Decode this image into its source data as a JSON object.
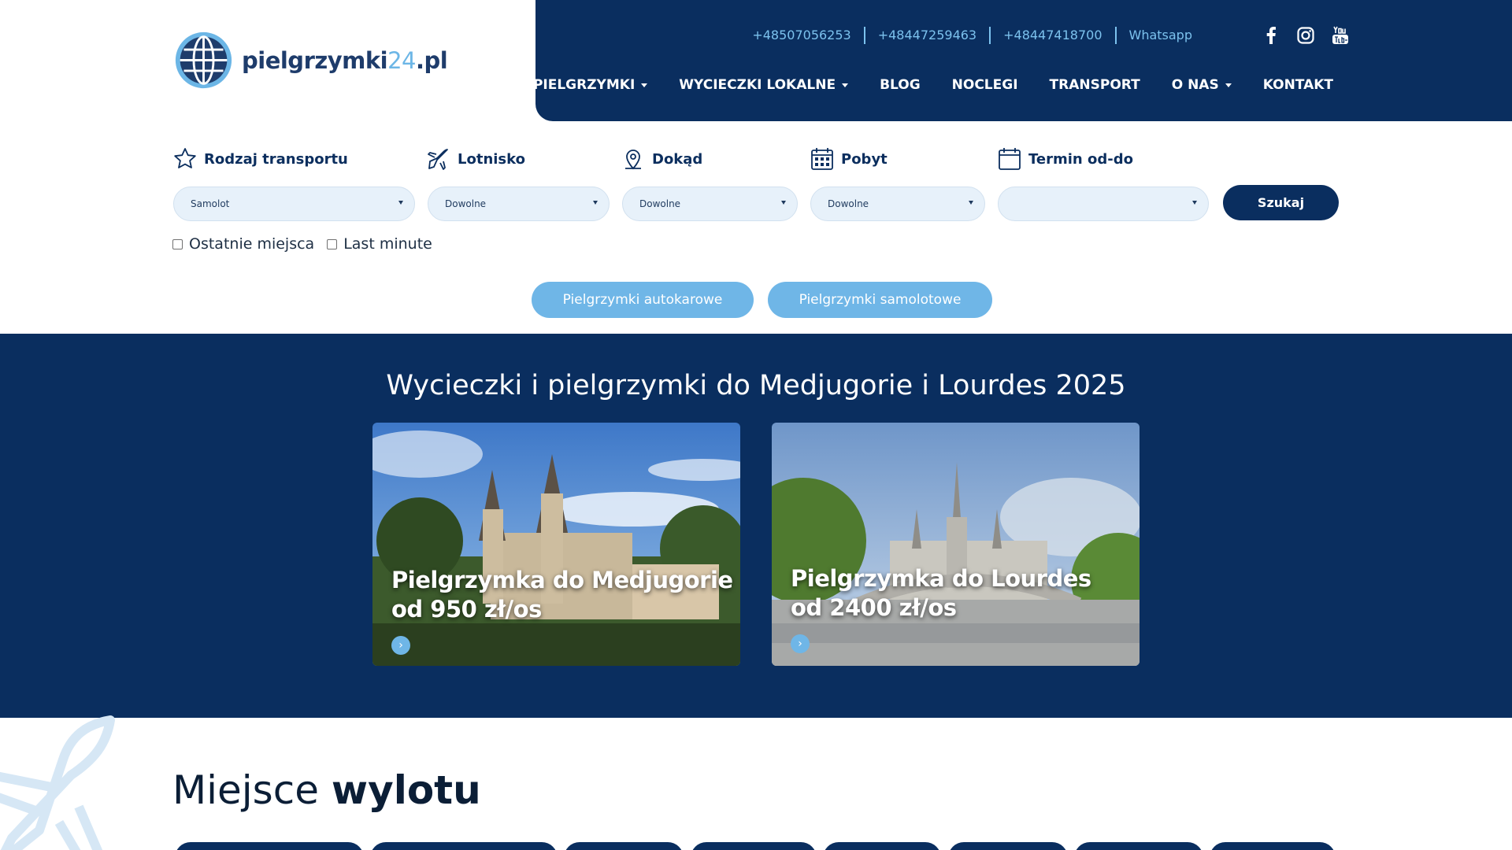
{
  "brand": {
    "name_main": "pielgrzymki",
    "name_accent": "24",
    "name_suffix": ".pl"
  },
  "header": {
    "contacts": [
      "+48507056253",
      "+48447259463",
      "+48447418700",
      "Whatsapp"
    ],
    "socials": [
      "facebook-icon",
      "instagram-icon",
      "youtube-icon"
    ],
    "nav": [
      {
        "label": "PIELGRZYMKI",
        "dropdown": true
      },
      {
        "label": "WYCIECZKI LOKALNE",
        "dropdown": true
      },
      {
        "label": "BLOG",
        "dropdown": false
      },
      {
        "label": "NOCLEGI",
        "dropdown": false
      },
      {
        "label": "TRANSPORT",
        "dropdown": false
      },
      {
        "label": "O NAS",
        "dropdown": true
      },
      {
        "label": "KONTAKT",
        "dropdown": false
      }
    ]
  },
  "search": {
    "labels": {
      "transport": "Rodzaj transportu",
      "airport": "Lotnisko",
      "destination": "Dokąd",
      "stay": "Pobyt",
      "dates": "Termin od-do"
    },
    "values": {
      "transport": "Samolot",
      "airport": "Dowolne",
      "destination": "Dowolne",
      "stay": "Dowolne",
      "dates": ""
    },
    "submit": "Szukaj",
    "checkboxes": [
      "Ostatnie miejsca",
      "Last minute"
    ],
    "quick_links": [
      "Pielgrzymki autokarowe",
      "Pielgrzymki samolotowe"
    ]
  },
  "featured": {
    "title": "Wycieczki i pielgrzymki do Medjugorie i Lourdes 2025",
    "cards": [
      {
        "line1": "Pielgrzymka do Medjugorie",
        "line2": "od 950 zł/os"
      },
      {
        "line1": "Pielgrzymka do Lourdes",
        "line2": "od 2400 zł/os"
      }
    ]
  },
  "departures": {
    "title_regular": "Miejsce",
    "title_bold": "wylotu"
  },
  "colors": {
    "navy": "#0a2e5f",
    "light_blue": "#6fb6e7",
    "field_bg": "#e7f1fa"
  }
}
